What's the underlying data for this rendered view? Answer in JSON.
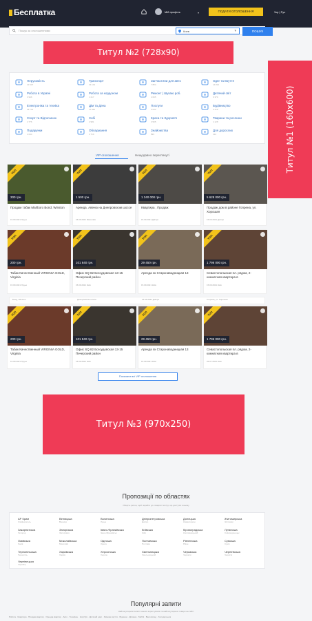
{
  "header": {
    "logo": "Бесплатка",
    "profile": "Мій профіль",
    "submit_button": "Подати оголошення",
    "language": "Укр | Рус"
  },
  "search": {
    "placeholder": "Пошук за оголошеннями",
    "region": "Киев",
    "button": "Пошук"
  },
  "ads": {
    "top": "Титул №2 (728x90)",
    "side": "Титул №1 (160x600)",
    "bottom": "Титул №3 (970x250)"
  },
  "categories": [
    {
      "name": "Нерухомість",
      "count": "12 637",
      "icon": "house-icon"
    },
    {
      "name": "Транспорт",
      "count": "23 101",
      "icon": "car-icon"
    },
    {
      "name": "Запчастини для авто",
      "count": "7 854",
      "icon": "wheel-icon"
    },
    {
      "name": "Одяг та Взуття",
      "count": "14 812",
      "icon": "shirt-icon"
    },
    {
      "name": "Робота в Україні",
      "count": "3 946",
      "icon": "briefcase-icon"
    },
    {
      "name": "Робота за кордоном",
      "count": "1 217",
      "icon": "globe-icon"
    },
    {
      "name": "Ремонт | Шукаю роб.",
      "count": "2 065",
      "icon": "tools-icon"
    },
    {
      "name": "Дитячий світ",
      "count": "9 370",
      "icon": "stroller-icon"
    },
    {
      "name": "Електроніка та техніка",
      "count": "18 744",
      "icon": "laptop-icon"
    },
    {
      "name": "Дім та Дача",
      "count": "11 589",
      "icon": "sofa-icon"
    },
    {
      "name": "Послуги",
      "count": "6 032",
      "icon": "service-icon"
    },
    {
      "name": "Будівництво",
      "count": "5 418",
      "icon": "crane-icon"
    },
    {
      "name": "Спорт та Відпочинок",
      "count": "4 776",
      "icon": "ball-icon"
    },
    {
      "name": "Хобі",
      "count": "2 981",
      "icon": "guitar-icon"
    },
    {
      "name": "Краса та Здоров'я",
      "count": "3 505",
      "icon": "heart-icon"
    },
    {
      "name": "Тварини та рослини",
      "count": "4 128",
      "icon": "paw-icon"
    },
    {
      "name": "Подарунки",
      "count": "1 044",
      "icon": "gift-icon"
    },
    {
      "name": "Обладнання",
      "count": "2 719",
      "icon": "gear-icon"
    },
    {
      "name": "Знайомства",
      "count": "893",
      "icon": "people-icon"
    },
    {
      "name": "Для дорослих",
      "count": "412",
      "icon": "eighteen-icon"
    }
  ],
  "tabs": [
    "VIP оголошення",
    "Нещодавно переглянуті"
  ],
  "ribbon": "ТОП",
  "listings_row1": [
    {
      "price": "300 грн.",
      "title": "Продам табак Marlboro Bond, Winston",
      "meta": "15.09.2021 Луцьк",
      "photo": "#4a5a2e"
    },
    {
      "price": "1 500 грн.",
      "title": "Аренда. Авеню на Днепровском шоссе",
      "meta": "15.09.2021 Миколаїв",
      "photo": "#3c3c3c"
    },
    {
      "price": "1 340 000 грн.",
      "title": "Квартира , Продаж",
      "meta": "15.09.2021 Дніпро",
      "photo": "#4d4a46"
    },
    {
      "price": "5 628 000 грн.",
      "title": "Продаж дом в районе Гопрена, ул. Хорошая",
      "meta": "15.09.2021 Дніпро",
      "photo": "#5b5650"
    }
  ],
  "listings_row2": [
    {
      "price": "200 грн.",
      "title": "Табак Качественный VIRGINIA GOLD, Virginia",
      "meta": "15.09.2021 Луцьк",
      "photo": "#6b3a2a"
    },
    {
      "price": "101 840 грн.",
      "title": "Офис SQ 82 Богоудовская 13-15 Печерский район",
      "meta": "15.09.2021 Київ",
      "photo": "#3a352f"
    },
    {
      "price": "29 450 грн.",
      "title": "Аренда 4к Старонаводницкая 13",
      "meta": "15.09.2021 Київ",
      "photo": "#7a6a58"
    },
    {
      "price": "1 796 000 грн.",
      "title": "Севастопольская пл. рядом, 2-комнатная квартира в",
      "meta": "15.09.2021 Київ",
      "photo": "#5e4436"
    }
  ],
  "strip": [
    "Бонд, Winston",
    "Днепровском шоссе",
    "15.09.2021 Дніпро",
    "Гопрена, ул. Хорошая"
  ],
  "listings_row3": [
    {
      "price": "200 грн.",
      "title": "Табак Качественный VIRGINIA GOLD, Virginia",
      "meta": "15.09.2021 Луцьк",
      "photo": "#6b3a2a"
    },
    {
      "price": "101 840 грн.",
      "title": "Офис SQ 82 Богоудовская 13-15 Печерский район",
      "meta": "15.09.2021 Київ",
      "photo": "#3a352f"
    },
    {
      "price": "29 450 грн.",
      "title": "Аренда 4к Старонаводницкая 13",
      "meta": "15.09.2021 Київ",
      "photo": "#7a6a58"
    },
    {
      "price": "1 796 000 грн.",
      "title": "Севастопольская пл. рядом, 2-комнатная квартира в",
      "meta": "25.07.2021 Київ",
      "photo": "#5e4436"
    }
  ],
  "more_vip": "Показати всі VIP оголошення",
  "regions_section": {
    "title": "Пропозиції по областях",
    "subtitle": "Оберіть регіон, щоб перейти до товарів і послуг, що доступні в ньому",
    "regions": [
      {
        "name": "АР Крим",
        "sub": "Сімферополь"
      },
      {
        "name": "Вінницька",
        "sub": "Вінниця"
      },
      {
        "name": "Волинська",
        "sub": "Луцьк"
      },
      {
        "name": "Дніпропетровська",
        "sub": "Дніпро"
      },
      {
        "name": "Донецька",
        "sub": "Краматорськ"
      },
      {
        "name": "Житомирська",
        "sub": "Житомир"
      },
      {
        "name": "Закарпатська",
        "sub": "Ужгород"
      },
      {
        "name": "Запорізька",
        "sub": "Запоріжжя"
      },
      {
        "name": "Івано-Франківська",
        "sub": "Івано-Франківськ"
      },
      {
        "name": "Київська",
        "sub": "Київ"
      },
      {
        "name": "Кіровоградська",
        "sub": "Кропивницький"
      },
      {
        "name": "Луганська",
        "sub": "Сєвєродонецьк"
      },
      {
        "name": "Львівська",
        "sub": "Львів"
      },
      {
        "name": "Миколаївська",
        "sub": "Миколаїв"
      },
      {
        "name": "Одеська",
        "sub": "Одеса"
      },
      {
        "name": "Полтавська",
        "sub": "Полтава"
      },
      {
        "name": "Рівненська",
        "sub": "Рівне"
      },
      {
        "name": "Сумська",
        "sub": "Суми"
      },
      {
        "name": "Тернопільська",
        "sub": "Тернопіль"
      },
      {
        "name": "Харківська",
        "sub": "Харків"
      },
      {
        "name": "Херсонська",
        "sub": "Херсон"
      },
      {
        "name": "Хмельницька",
        "sub": "Хмельницький"
      },
      {
        "name": "Черкаська",
        "sub": "Черкаси"
      },
      {
        "name": "Чернігівська",
        "sub": "Чернігів"
      },
      {
        "name": "Чернівецька",
        "sub": "Чернівці"
      }
    ]
  },
  "popular_section": {
    "title": "Популярні запити",
    "subtitle": "Найпопулярніші запити наших користувачів та найпопулярніші товари на сайті",
    "links": "Робота · Квартира · Продаж квартир · Оренда квартир · Авто · Телефон · Ноутбук · Дитячий одяг · Зимове взуття · Будинок · Ділянка · Меблі · Велосипед · Холодильник"
  },
  "colors": {
    "header_bg": "#202431",
    "accent_yellow": "#f2c31b",
    "link_blue": "#2f80ed",
    "ad_red": "#ef3b56"
  }
}
